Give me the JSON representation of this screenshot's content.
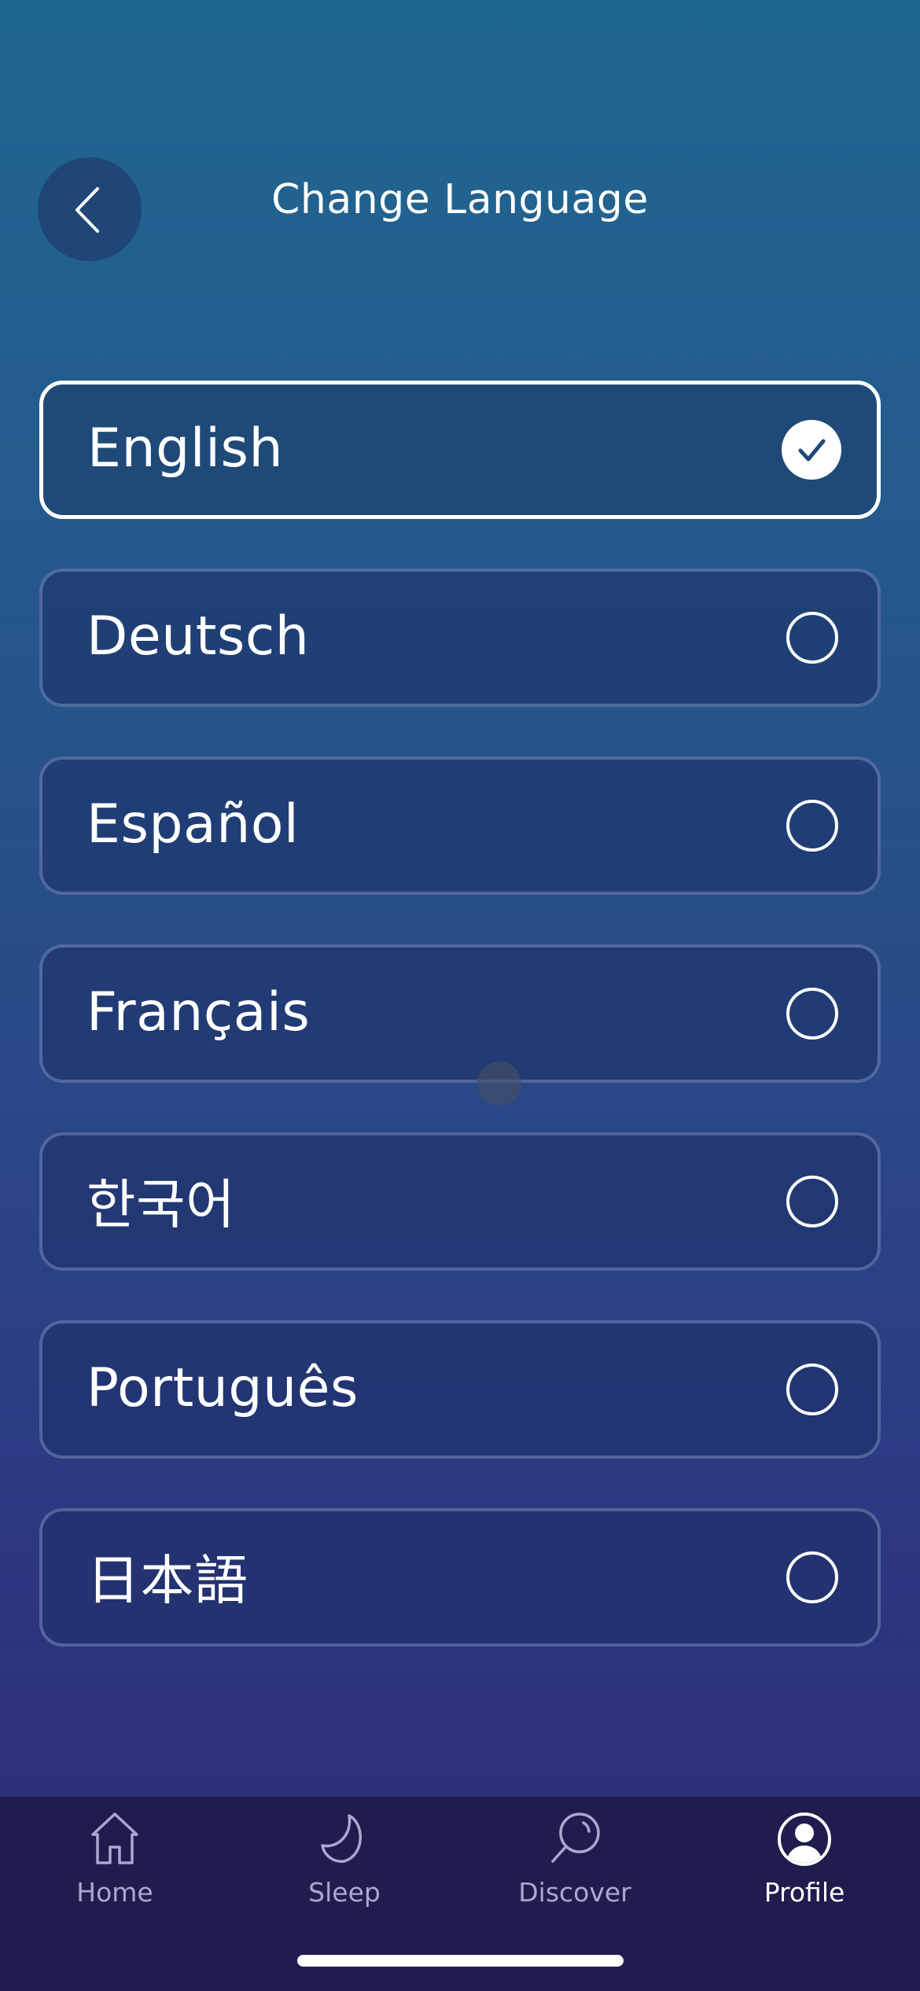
{
  "header": {
    "title": "Change Language",
    "back_icon": "chevron-left-icon"
  },
  "languages": [
    {
      "label": "English",
      "selected": true
    },
    {
      "label": "Deutsch",
      "selected": false
    },
    {
      "label": "Español",
      "selected": false
    },
    {
      "label": "Français",
      "selected": false
    },
    {
      "label": "한국어",
      "selected": false
    },
    {
      "label": "Português",
      "selected": false
    },
    {
      "label": "日本語",
      "selected": false
    }
  ],
  "tabs": [
    {
      "label": "Home",
      "icon": "home-icon",
      "active": false
    },
    {
      "label": "Sleep",
      "icon": "moon-icon",
      "active": false
    },
    {
      "label": "Discover",
      "icon": "search-icon",
      "active": false
    },
    {
      "label": "Profile",
      "icon": "profile-icon",
      "active": true
    }
  ],
  "colors": {
    "tab_inactive": "#a7a9cf",
    "tab_active": "#ffffff",
    "tab_bar_bg": "#1e1d4d"
  }
}
